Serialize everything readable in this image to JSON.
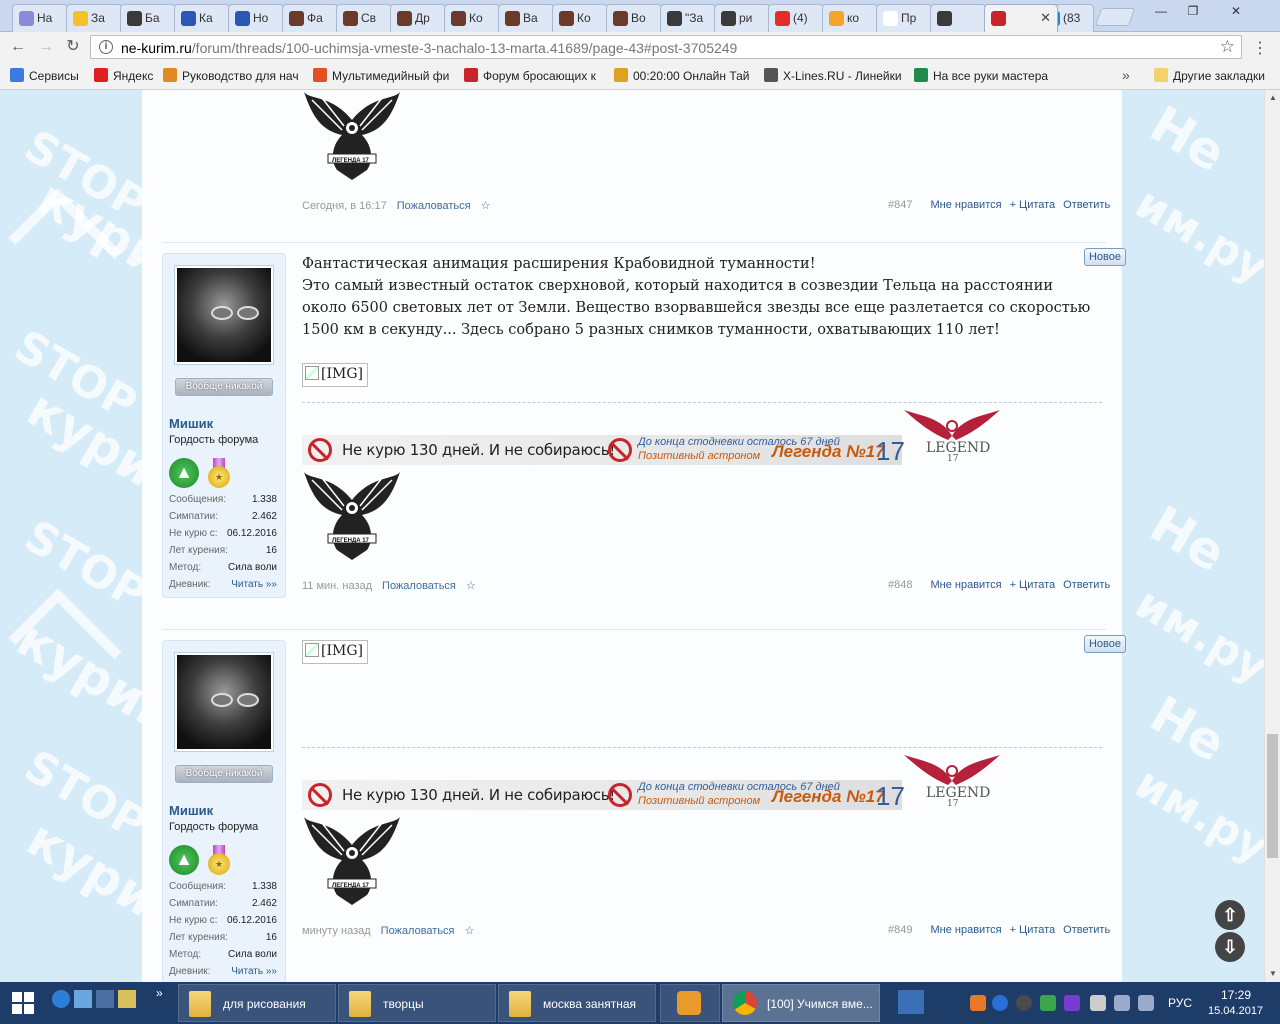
{
  "browser": {
    "tabs": [
      {
        "label": "На",
        "color": "#8a8ad8",
        "icon": "app-icon"
      },
      {
        "label": "За",
        "color": "#f3c12a",
        "icon": "smile-icon"
      },
      {
        "label": "Ба",
        "color": "#3a3a3a",
        "icon": "play-icon"
      },
      {
        "label": "Ка",
        "color": "#2c55b5",
        "icon": "vk-icon"
      },
      {
        "label": "Но",
        "color": "#2c55b5",
        "icon": "vk-icon"
      },
      {
        "label": "Фа",
        "color": "#6b3a2a",
        "icon": "face-icon"
      },
      {
        "label": "Св",
        "color": "#6b3a2a",
        "icon": "face-icon"
      },
      {
        "label": "Др",
        "color": "#6b3a2a",
        "icon": "face-icon"
      },
      {
        "label": "Ко",
        "color": "#6b3a2a",
        "icon": "face-icon"
      },
      {
        "label": "Ва",
        "color": "#6b3a2a",
        "icon": "face-icon"
      },
      {
        "label": "Ко",
        "color": "#6b3a2a",
        "icon": "face-icon"
      },
      {
        "label": "Во",
        "color": "#6b3a2a",
        "icon": "face-icon"
      },
      {
        "label": "\"За",
        "color": "#3a3a3a",
        "icon": "play-icon"
      },
      {
        "label": "ри",
        "color": "#3a3a3a",
        "icon": "play-icon"
      },
      {
        "label": "(4)",
        "color": "#e52d27",
        "icon": "youtube-icon"
      },
      {
        "label": "ко",
        "color": "#f3a52a",
        "icon": "image-icon"
      },
      {
        "label": "Пр",
        "color": "#ffffff",
        "icon": "wiki-icon"
      },
      {
        "label": "",
        "color": "#3a3a3a",
        "icon": "play-icon"
      },
      {
        "label": "",
        "color": "#c8252a",
        "icon": "forum-icon"
      },
      {
        "label": "(83",
        "color": "#1c8ad6",
        "icon": "mail-icon"
      }
    ],
    "url_host": "ne-kurim.ru",
    "url_path": "/forum/threads/100-uchimsja-vmeste-3-nachalo-13-marta.41689/page-43#post-3705249",
    "bookmarks": [
      {
        "label": "Сервисы",
        "color": "#3b7be0"
      },
      {
        "label": "Яндекс",
        "color": "#e02020"
      },
      {
        "label": "Руководство для нач",
        "color": "#e08a20"
      },
      {
        "label": "Мультимедийный фи",
        "color": "#e05020"
      },
      {
        "label": "Форум бросающих к",
        "color": "#c8252a"
      },
      {
        "label": "00:20:00 Онлайн Тай",
        "color": "#e0a020"
      },
      {
        "label": "X-Lines.RU - Линейки",
        "color": "#555555"
      },
      {
        "label": "На все руки мастера",
        "color": "#1f8a4a"
      }
    ],
    "bookmarks_other": "Другие закладки"
  },
  "posts": [
    {
      "number": "#847",
      "time": "Сегодня, в 16:17",
      "report": "Пожаловаться",
      "star": "☆",
      "like": "Мне нравится",
      "quote": "+ Цитата",
      "reply": "Ответить",
      "eagle_text": "ЛЕГЕНДА 17"
    },
    {
      "number": "#848",
      "time": "11 мин. назад",
      "report": "Пожаловаться",
      "star": "☆",
      "like": "Мне нравится",
      "quote": "+ Цитата",
      "reply": "Ответить",
      "new_badge": "Новое",
      "text_line1": "Фантастическая анимация расширения Крабовидной туманности!",
      "text_body": "Это самый известный остаток сверхновой, который находится в созвездии Тельца на расстоянии около 6500 световых лет от Земли. Вещество взорвавшейся звезды все еще разлетается со скоростью 1500 км в секунду... Здесь собрано 5 разных снимков туманности, охватывающих 110 лет!",
      "img_alt": "[IMG]",
      "eagle_text": "ЛЕГЕНДА 17",
      "user": {
        "rank_button": "Вообще никакой",
        "name": "Мишик",
        "title": "Гордость форума",
        "stats": [
          {
            "k": "Сообщения:",
            "v": "1.338"
          },
          {
            "k": "Симпатии:",
            "v": "2.462"
          },
          {
            "k": "Не курю с:",
            "v": "06.12.2016"
          },
          {
            "k": "Лет курения:",
            "v": "16"
          },
          {
            "k": "Метод:",
            "v": "Сила воли"
          },
          {
            "k": "Дневник:",
            "v": "Читать »»"
          }
        ]
      }
    },
    {
      "number": "#849",
      "time": "минуту назад",
      "report": "Пожаловаться",
      "star": "☆",
      "like": "Мне нравится",
      "quote": "+ Цитата",
      "reply": "Ответить",
      "new_badge": "Новое",
      "img_alt": "[IMG]",
      "eagle_text": "ЛЕГЕНДА 17",
      "user": {
        "rank_button": "Вообще никакой",
        "name": "Мишик",
        "title": "Гордость форума",
        "stats": [
          {
            "k": "Сообщения:",
            "v": "1.338"
          },
          {
            "k": "Симпатии:",
            "v": "2.462"
          },
          {
            "k": "Не курю с:",
            "v": "06.12.2016"
          },
          {
            "k": "Лет курения:",
            "v": "16"
          },
          {
            "k": "Метод:",
            "v": "Сила воли"
          },
          {
            "k": "Дневник:",
            "v": "Читать »»"
          }
        ]
      }
    }
  ],
  "signature": {
    "main": "Не курю 130 дней. И не собираюсь!",
    "sub1": "До конца стодневки осталось 67 дней",
    "sub2": "Позитивный астроном",
    "legend": "Легенда №17",
    "num": "17",
    "logo_text": "LEGEND",
    "logo_num": "17"
  },
  "watermark": {
    "stop": "STOP",
    "kurim": "курим",
    "ne": "Не",
    "ru": "им.ру"
  },
  "taskbar": {
    "buttons": [
      {
        "label": "для рисования"
      },
      {
        "label": "творцы"
      },
      {
        "label": "москва занятная"
      },
      {
        "label": "[100] Учимся вме..."
      }
    ],
    "lang": "РУС",
    "time": "17:29",
    "date": "15.04.2017"
  },
  "colors": {
    "accent": "#2b5a8c",
    "page_bg": "#d6ebf8",
    "taskbar": "#1e3c68"
  }
}
